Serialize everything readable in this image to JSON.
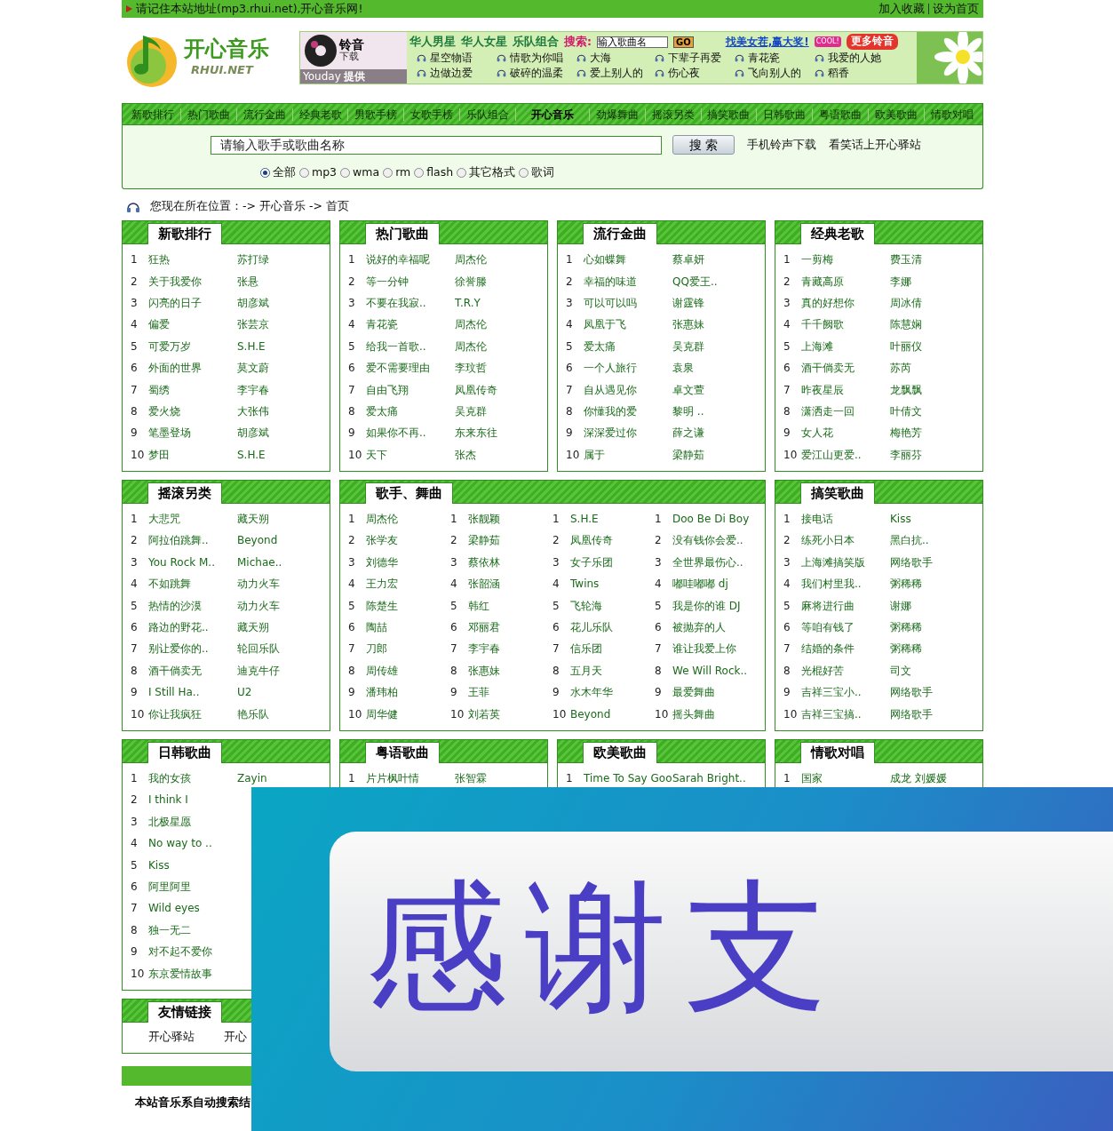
{
  "top_bar": {
    "notice": "请记住本站地址(mp3.rhui.net),开心音乐网!",
    "links": [
      "加入收藏",
      "设为首页"
    ]
  },
  "logo": {
    "name": "开心音乐",
    "sub": "RHUI.NET"
  },
  "banner": {
    "badge": "铃音",
    "badge_sub": "下载",
    "provider": "Youday",
    "provider_suffix": "提供",
    "categories": [
      "华人男星",
      "华人女星",
      "乐队组合"
    ],
    "search_label": "搜索:",
    "search_value": "输入歌曲名",
    "go": "GO",
    "promo": "找美女茬,赢大奖!",
    "cool": "COOL!",
    "more": "更多铃音",
    "songs": [
      [
        "星空物语",
        "情歌为你唱",
        "大海",
        "下辈子再爱",
        "青花瓷",
        "我爱的人她"
      ],
      [
        "边做边爱",
        "破碎的温柔",
        "爱上别人的",
        "伤心夜",
        "飞向别人的",
        "稻香"
      ]
    ]
  },
  "nav": [
    {
      "label": "新歌排行",
      "selected": false
    },
    {
      "label": "热门歌曲",
      "selected": false
    },
    {
      "label": "流行金曲",
      "selected": false
    },
    {
      "label": "经典老歌",
      "selected": false
    },
    {
      "label": "男歌手榜",
      "selected": false
    },
    {
      "label": "女歌手榜",
      "selected": false
    },
    {
      "label": "乐队组合",
      "selected": false
    },
    {
      "label": "开心音乐",
      "selected": true
    },
    {
      "label": "劲爆舞曲",
      "selected": false
    },
    {
      "label": "摇滚另类",
      "selected": false
    },
    {
      "label": "搞笑歌曲",
      "selected": false
    },
    {
      "label": "日韩歌曲",
      "selected": false
    },
    {
      "label": "粤语歌曲",
      "selected": false
    },
    {
      "label": "欧美歌曲",
      "selected": false
    },
    {
      "label": "情歌对唱",
      "selected": false
    }
  ],
  "search": {
    "value": "请输入歌手或歌曲名称",
    "button": "搜 索",
    "links": [
      "手机铃声下载",
      "看笑话上开心驿站"
    ],
    "formats": [
      {
        "label": "全部",
        "selected": true
      },
      {
        "label": "mp3",
        "selected": false
      },
      {
        "label": "wma",
        "selected": false
      },
      {
        "label": "rm",
        "selected": false
      },
      {
        "label": "flash",
        "selected": false
      },
      {
        "label": "其它格式",
        "selected": false
      },
      {
        "label": "歌词",
        "selected": false
      }
    ]
  },
  "breadcrumb": "您现在所在位置：-> 开心音乐 -> 首页",
  "sections": [
    [
      {
        "kind": "songs",
        "title": "新歌排行",
        "items": [
          {
            "no": "1",
            "song": "狂热",
            "artist": "苏打绿"
          },
          {
            "no": "2",
            "song": "关于我爱你",
            "artist": "张悬"
          },
          {
            "no": "3",
            "song": "闪亮的日子",
            "artist": "胡彦斌"
          },
          {
            "no": "4",
            "song": "偏爱",
            "artist": "张芸京"
          },
          {
            "no": "5",
            "song": "可爱万岁",
            "artist": "S.H.E"
          },
          {
            "no": "6",
            "song": "外面的世界",
            "artist": "莫文蔚"
          },
          {
            "no": "7",
            "song": "蜀绣",
            "artist": "李宇春"
          },
          {
            "no": "8",
            "song": "爱火烧",
            "artist": "大张伟"
          },
          {
            "no": "9",
            "song": "笔墨登场",
            "artist": "胡彦斌"
          },
          {
            "no": "10",
            "song": "梦田",
            "artist": "S.H.E"
          }
        ]
      },
      {
        "kind": "songs",
        "title": "热门歌曲",
        "items": [
          {
            "no": "1",
            "song": "说好的幸福呢",
            "artist": "周杰伦"
          },
          {
            "no": "2",
            "song": "等一分钟",
            "artist": "徐誉滕"
          },
          {
            "no": "3",
            "song": "不要在我寂..",
            "artist": "T.R.Y"
          },
          {
            "no": "4",
            "song": "青花瓷",
            "artist": "周杰伦"
          },
          {
            "no": "5",
            "song": "给我一首歌..",
            "artist": "周杰伦"
          },
          {
            "no": "6",
            "song": "爱不需要理由",
            "artist": "李玟哲"
          },
          {
            "no": "7",
            "song": "自由飞翔",
            "artist": "凤凰传奇"
          },
          {
            "no": "8",
            "song": "爱太痛",
            "artist": "吴克群"
          },
          {
            "no": "9",
            "song": "如果你不再..",
            "artist": "东来东往"
          },
          {
            "no": "10",
            "song": "天下",
            "artist": "张杰"
          }
        ]
      },
      {
        "kind": "songs",
        "title": "流行金曲",
        "items": [
          {
            "no": "1",
            "song": "心如蝶舞",
            "artist": "蔡卓妍"
          },
          {
            "no": "2",
            "song": "幸福的味道",
            "artist": "QQ爱王.."
          },
          {
            "no": "3",
            "song": "可以可以吗",
            "artist": "谢霆锋"
          },
          {
            "no": "4",
            "song": "凤凰于飞",
            "artist": "张惠妹"
          },
          {
            "no": "5",
            "song": "爱太痛",
            "artist": "吴克群"
          },
          {
            "no": "6",
            "song": "一个人旅行",
            "artist": "袁泉"
          },
          {
            "no": "7",
            "song": "自从遇见你",
            "artist": "卓文萱"
          },
          {
            "no": "8",
            "song": "你懂我的爱",
            "artist": "黎明 .."
          },
          {
            "no": "9",
            "song": "深深爱过你",
            "artist": "薛之谦"
          },
          {
            "no": "10",
            "song": "属于",
            "artist": "梁静茹"
          }
        ]
      },
      {
        "kind": "songs",
        "title": "经典老歌",
        "items": [
          {
            "no": "1",
            "song": "一剪梅",
            "artist": "费玉清"
          },
          {
            "no": "2",
            "song": "青藏高原",
            "artist": "李娜"
          },
          {
            "no": "3",
            "song": "真的好想你",
            "artist": "周冰倩"
          },
          {
            "no": "4",
            "song": "千千阙歌",
            "artist": "陈慧娴"
          },
          {
            "no": "5",
            "song": "上海滩",
            "artist": "叶丽仪"
          },
          {
            "no": "6",
            "song": "酒干倘卖无",
            "artist": "苏芮"
          },
          {
            "no": "7",
            "song": "昨夜星辰",
            "artist": "龙飘飘"
          },
          {
            "no": "8",
            "song": "潇洒走一回",
            "artist": "叶倩文"
          },
          {
            "no": "9",
            "song": "女人花",
            "artist": "梅艳芳"
          },
          {
            "no": "10",
            "song": "爱江山更爱..",
            "artist": "李丽芬"
          }
        ]
      }
    ],
    [
      {
        "kind": "songs",
        "title": "摇滚另类",
        "items": [
          {
            "no": "1",
            "song": "大悲咒",
            "artist": "藏天朔"
          },
          {
            "no": "2",
            "song": "阿拉伯跳舞..",
            "artist": "Beyond"
          },
          {
            "no": "3",
            "song": "You Rock M..",
            "artist": "Michae.."
          },
          {
            "no": "4",
            "song": "不如跳舞",
            "artist": "动力火车"
          },
          {
            "no": "5",
            "song": "热情的沙漠",
            "artist": "动力火车"
          },
          {
            "no": "6",
            "song": "路边的野花..",
            "artist": "藏天朔"
          },
          {
            "no": "7",
            "song": "别让爱你的..",
            "artist": "轮回乐队"
          },
          {
            "no": "8",
            "song": "酒干倘卖无",
            "artist": "迪克牛仔"
          },
          {
            "no": "9",
            "song": "I Still Ha..",
            "artist": "U2"
          },
          {
            "no": "10",
            "song": "你让我疯狂",
            "artist": "艳乐队"
          }
        ]
      },
      {
        "kind": "singers",
        "title": "歌手、舞曲",
        "columns": [
          [
            {
              "no": "1",
              "name": "周杰伦"
            },
            {
              "no": "2",
              "name": "张学友"
            },
            {
              "no": "3",
              "name": "刘德华"
            },
            {
              "no": "4",
              "name": "王力宏"
            },
            {
              "no": "5",
              "name": "陈楚生"
            },
            {
              "no": "6",
              "name": "陶喆"
            },
            {
              "no": "7",
              "name": "刀郎"
            },
            {
              "no": "8",
              "name": "周传雄"
            },
            {
              "no": "9",
              "name": "潘玮柏"
            },
            {
              "no": "10",
              "name": "周华健"
            }
          ],
          [
            {
              "no": "1",
              "name": "张靓颖"
            },
            {
              "no": "2",
              "name": "梁静茹"
            },
            {
              "no": "3",
              "name": "蔡依林"
            },
            {
              "no": "4",
              "name": "张韶涵"
            },
            {
              "no": "5",
              "name": "韩红"
            },
            {
              "no": "6",
              "name": "邓丽君"
            },
            {
              "no": "7",
              "name": "李宇春"
            },
            {
              "no": "8",
              "name": "张惠妹"
            },
            {
              "no": "9",
              "name": "王菲"
            },
            {
              "no": "10",
              "name": "刘若英"
            }
          ],
          [
            {
              "no": "1",
              "name": "S.H.E"
            },
            {
              "no": "2",
              "name": "凤凰传奇"
            },
            {
              "no": "3",
              "name": "女子乐团"
            },
            {
              "no": "4",
              "name": "Twins"
            },
            {
              "no": "5",
              "name": "飞轮海"
            },
            {
              "no": "6",
              "name": "花儿乐队"
            },
            {
              "no": "7",
              "name": "信乐团"
            },
            {
              "no": "8",
              "name": "五月天"
            },
            {
              "no": "9",
              "name": "水木年华"
            },
            {
              "no": "10",
              "name": "Beyond"
            }
          ],
          [
            {
              "no": "1",
              "name": "Doo Be Di Boy"
            },
            {
              "no": "2",
              "name": "没有钱你会爱.."
            },
            {
              "no": "3",
              "name": "全世界最伤心.."
            },
            {
              "no": "4",
              "name": "嘟哇嘟嘟 dj"
            },
            {
              "no": "5",
              "name": "我是你的谁 DJ"
            },
            {
              "no": "6",
              "name": "被抛弃的人"
            },
            {
              "no": "7",
              "name": "谁让我爱上你"
            },
            {
              "no": "8",
              "name": "We Will Rock.."
            },
            {
              "no": "9",
              "name": "最爱舞曲"
            },
            {
              "no": "10",
              "name": "摇头舞曲"
            }
          ]
        ]
      },
      {
        "kind": "songs",
        "title": "搞笑歌曲",
        "items": [
          {
            "no": "1",
            "song": "接电话",
            "artist": "Kiss"
          },
          {
            "no": "2",
            "song": "练死小日本",
            "artist": "黑白抗.."
          },
          {
            "no": "3",
            "song": "上海滩搞笑版",
            "artist": "网络歌手"
          },
          {
            "no": "4",
            "song": "我们村里我..",
            "artist": "粥稀稀"
          },
          {
            "no": "5",
            "song": "麻将进行曲",
            "artist": "谢娜"
          },
          {
            "no": "6",
            "song": "等咱有钱了",
            "artist": "粥稀稀"
          },
          {
            "no": "7",
            "song": "结婚的条件",
            "artist": "粥稀稀"
          },
          {
            "no": "8",
            "song": "光棍好苦",
            "artist": "司文"
          },
          {
            "no": "9",
            "song": "吉祥三宝小..",
            "artist": "网络歌手"
          },
          {
            "no": "10",
            "song": "吉祥三宝搞..",
            "artist": "网络歌手"
          }
        ]
      }
    ],
    [
      {
        "kind": "songs",
        "title": "日韩歌曲",
        "items": [
          {
            "no": "1",
            "song": "我的女孩",
            "artist": "Zayin"
          },
          {
            "no": "2",
            "song": "I think I"
          },
          {
            "no": "3",
            "song": "北极星愿"
          },
          {
            "no": "4",
            "song": "No way to .."
          },
          {
            "no": "5",
            "song": "Kiss"
          },
          {
            "no": "6",
            "song": "阿里阿里"
          },
          {
            "no": "7",
            "song": "Wild eyes"
          },
          {
            "no": "8",
            "song": "独一无二"
          },
          {
            "no": "9",
            "song": "对不起不爱你"
          },
          {
            "no": "10",
            "song": "东京爱情故事"
          }
        ]
      },
      {
        "kind": "songs",
        "title": "粤语歌曲",
        "items": [
          {
            "no": "1",
            "song": "片片枫叶情",
            "artist": "张智霖"
          }
        ]
      },
      {
        "kind": "songs",
        "title": "欧美歌曲",
        "items": [
          {
            "no": "1",
            "song": "Time To Say Goo",
            "artist": "Sarah Bright.."
          }
        ]
      },
      {
        "kind": "songs",
        "title": "情歌对唱",
        "items": [
          {
            "no": "1",
            "song": "国家",
            "artist": "成龙 刘媛媛"
          }
        ]
      }
    ]
  ],
  "friend_links": {
    "title": "友情链接",
    "links": [
      "开心驿站",
      "开心"
    ]
  },
  "footer": "本站音乐系自动搜索结",
  "overlay": {
    "text": "感谢支"
  }
}
